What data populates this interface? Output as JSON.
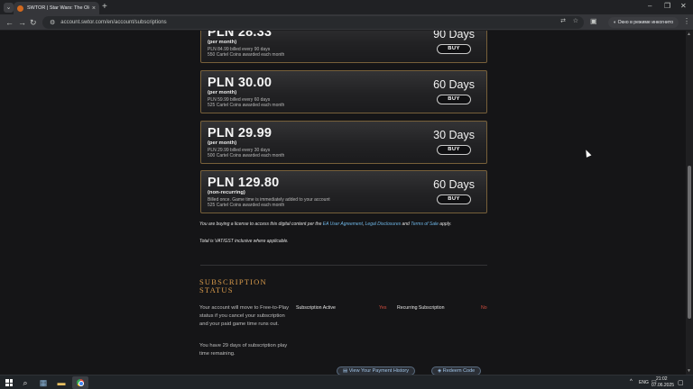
{
  "browser": {
    "tab_menu_icon": "chevron-down-icon",
    "tab_title": "SWTOR | Star Wars: The Old Re",
    "tab_close": "×",
    "new_tab": "+",
    "url": "account.swtor.com/en/account/subscriptions",
    "incognito_label": "Окно в режиме инкогнито",
    "window_controls": [
      "–",
      "❐",
      "✕"
    ]
  },
  "plans": [
    {
      "price": "PLN 28.33",
      "period": "(per month)",
      "line1": "PLN 84.99 billed every 90 days",
      "line2": "550 Cartel Coins awarded each month",
      "days": "90 Days",
      "buy": "BUY"
    },
    {
      "price": "PLN 30.00",
      "period": "(per month)",
      "line1": "PLN 59.99 billed every 60 days",
      "line2": "525 Cartel Coins awarded each month",
      "days": "60 Days",
      "buy": "BUY"
    },
    {
      "price": "PLN 29.99",
      "period": "(per month)",
      "line1": "PLN 29.99 billed every 30 days",
      "line2": "500 Cartel Coins awarded each month",
      "days": "30 Days",
      "buy": "BUY"
    },
    {
      "price": "PLN 129.80",
      "period": "(non-recurring)",
      "line1": "Billed once. Game time is immediately added to your account",
      "line2": "525 Cartel Coins awarded each month",
      "days": "60 Days",
      "buy": "BUY"
    }
  ],
  "legal": {
    "prefix": "You are buying a license to access this digital content per the ",
    "ea_link": "EA User Agreement",
    "sep": ", ",
    "disclosures_link": "Legal Disclosures",
    "and": " and ",
    "terms_link": "Terms of Sale",
    "suffix": " apply.",
    "vat": "Total is VAT/GST inclusive where applicable."
  },
  "subscription": {
    "title_line1": "SUBSCRIPTION",
    "title_line2": "STATUS",
    "info1": "Your account will move to Free-to-Play status if you cancel your subscription and your paid game time runs out.",
    "info2": "You have 29 days of subscription play time remaining.",
    "active_label": "Subscription Active",
    "active_value": "Yes",
    "recurring_label": "Recurring Subscription",
    "recurring_value": "No",
    "history_button": "View Your Payment History",
    "redeem_button": "Redeem Code"
  },
  "taskbar": {
    "lang": "ENG",
    "time": "21:02",
    "date": "07.06.2025"
  },
  "colors": {
    "accent": "#d89a4b",
    "link": "#6fb6e6",
    "status_red": "#d34d3f",
    "card_border": "#77603a"
  }
}
